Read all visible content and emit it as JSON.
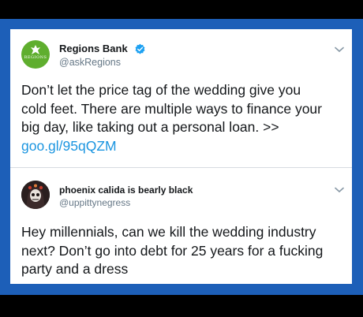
{
  "tweets": [
    {
      "name": "Regions Bank",
      "handle": "@askRegions",
      "verified": true,
      "avatar_text": "REGIONS",
      "lines": [
        "Don’t let the price tag of the wedding give you",
        "cold feet. There are multiple ways to finance your",
        "big day, like taking out a personal loan. >>"
      ],
      "link": "goo.gl/95qQZM"
    },
    {
      "name": "phoenix calida is bearly black",
      "handle": "@uppittynegress",
      "lines": [
        "Hey millennials, can we kill the wedding industry",
        "next? Don’t go into debt for 25 years for a fucking",
        "party and a dress"
      ]
    }
  ],
  "colors": {
    "frame": "#1d5fb8",
    "verified": "#1da1f2",
    "link": "#1b95e0"
  },
  "icons": {
    "verified": "verified-badge-icon",
    "menu": "chevron-down-icon"
  }
}
